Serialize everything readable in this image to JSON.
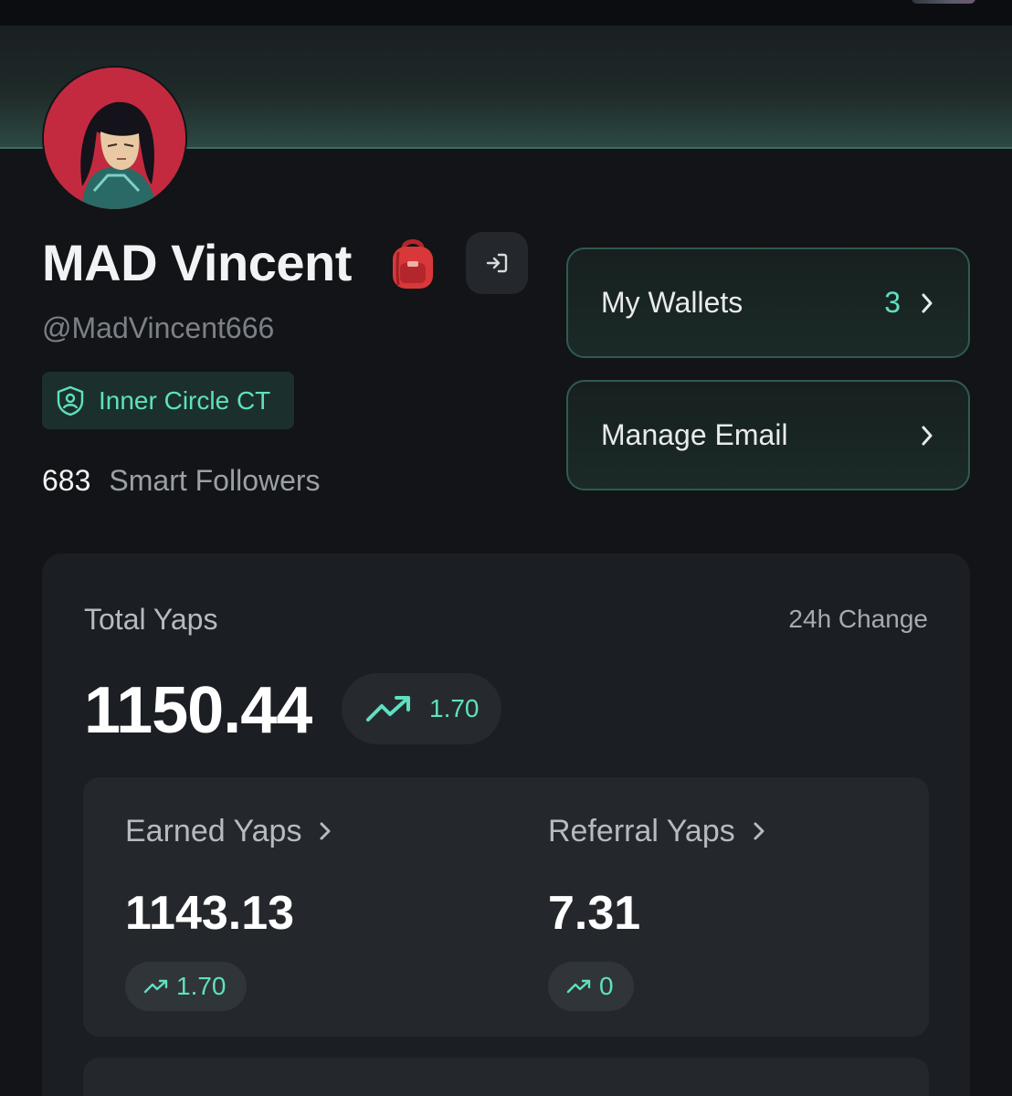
{
  "profile": {
    "name": "MAD Vincent",
    "name_emoji_icon": "backpack-icon",
    "handle": "@MadVincent666",
    "badge": {
      "icon": "shield-user-icon",
      "label": "Inner Circle CT"
    },
    "followers": {
      "count": "683",
      "label": "Smart Followers"
    }
  },
  "actions": {
    "wallets": {
      "label": "My Wallets",
      "count": "3"
    },
    "email": {
      "label": "Manage Email"
    }
  },
  "yaps": {
    "title": "Total Yaps",
    "change_label": "24h Change",
    "total": "1150.44",
    "total_change": "1.70",
    "earned": {
      "label": "Earned Yaps",
      "value": "1143.13",
      "change": "1.70"
    },
    "referral": {
      "label": "Referral Yaps",
      "value": "7.31",
      "change": "0"
    }
  },
  "colors": {
    "accent": "#5fe0c0",
    "background": "#121417",
    "card": "#1b1e22",
    "avatar_bg": "#c42a3f"
  }
}
